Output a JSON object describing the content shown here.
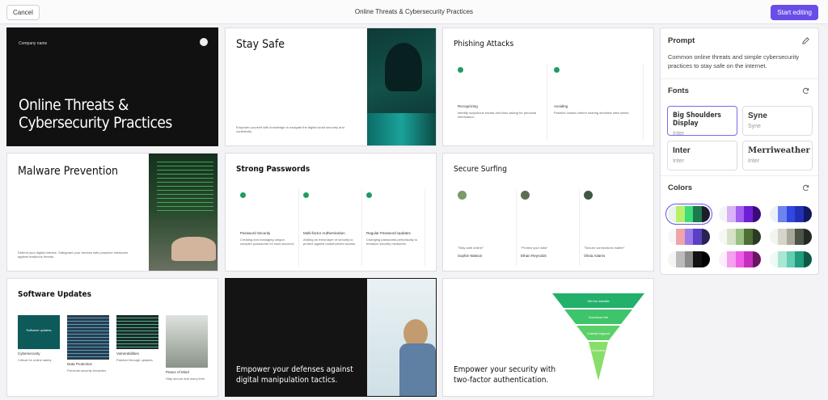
{
  "topbar": {
    "cancel": "Cancel",
    "title": "Online Threats & Cybersecurity Practices",
    "start": "Start editing"
  },
  "slides": {
    "s1": {
      "company": "Company name",
      "title": "Online Threats & Cybersecurity Practices"
    },
    "s2": {
      "title": "Stay Safe",
      "body": "Empower yourself with knowledge to navigate the digital world securely and confidently."
    },
    "s3": {
      "title": "Phishing Attacks",
      "items": [
        {
          "h": "Recognizing",
          "b": "Identify suspicious emails and links asking for personal information."
        },
        {
          "h": "Avoiding",
          "b": "Practice caution before sharing sensitive data online."
        }
      ]
    },
    "s4": {
      "title": "Malware Prevention",
      "body": "Defend your digital fortress. Safeguard your devices with proactive measures against malicious threats."
    },
    "s5": {
      "title": "Strong Passwords",
      "items": [
        {
          "h": "Password Security",
          "b": "Creating and managing unique, complex passwords for each account."
        },
        {
          "h": "Multi-factor Authentication",
          "b": "Adding an extra layer of security to protect against unauthorized access."
        },
        {
          "h": "Regular Password Updates",
          "b": "Changing passwords periodically to enhance security measures."
        }
      ]
    },
    "s6": {
      "title": "Secure Surfing",
      "items": [
        {
          "q": "\"Stay safe online!\"",
          "n": "Sophie Watson"
        },
        {
          "q": "\"Protect your data\"",
          "n": "Ethan Reynolds"
        },
        {
          "q": "\"Secure connections matter\"",
          "n": "Olivia Adams"
        }
      ]
    },
    "s7": {
      "title": "Software Updates",
      "items": [
        {
          "h": "Cybersecurity",
          "b": "Critical for online safety",
          "img": "Software updates"
        },
        {
          "h": "Data Protection",
          "b": "Prevents security breaches"
        },
        {
          "h": "Vulnerabilities",
          "b": "Patched through updates"
        },
        {
          "h": "Peace of Mind",
          "b": "Stay secure and worry-free"
        }
      ]
    },
    "s8": {
      "title": "Empower your defenses against digital manipulation tactics."
    },
    "s9": {
      "title": "Empower your security with two-factor authentication.",
      "levels": [
        "Set the website",
        "Download the",
        "Contact support",
        "Overview"
      ]
    }
  },
  "panel": {
    "prompt_title": "Prompt",
    "prompt_text": "Common online threats and simple cybersecurity practices to stay safe on the internet.",
    "fonts_title": "Fonts",
    "fonts": [
      {
        "name": "Big Shoulders Display",
        "sub": "Inter"
      },
      {
        "name": "Syne",
        "sub": "Syne"
      },
      {
        "name": "Inter",
        "sub": "Inter"
      },
      {
        "name": "Merriweather",
        "sub": "Inter"
      }
    ],
    "colors_title": "Colors",
    "palettes": [
      [
        "#e8f3ec",
        "#b7ef6a",
        "#3fdc7a",
        "#1b7a4e",
        "#1e1e2a"
      ],
      [
        "#f4f4f7",
        "#d8b3f7",
        "#a45ef0",
        "#6e1fd6",
        "#3b0a7a"
      ],
      [
        "#eef0f8",
        "#6d83ef",
        "#2f48e0",
        "#2230b8",
        "#11185e"
      ],
      [
        "#f7f7fa",
        "#f2a3a8",
        "#9a7be8",
        "#5b3fc4",
        "#2a2250"
      ],
      [
        "#f6f7f2",
        "#d7e3c8",
        "#9cbf83",
        "#4e6e36",
        "#2b3a22"
      ],
      [
        "#f4f4ef",
        "#d7d5c8",
        "#a9a79a",
        "#4b5447",
        "#222a22"
      ],
      [
        "#f4f4f4",
        "#bbbbbb",
        "#8a8a8a",
        "#111111",
        "#000000"
      ],
      [
        "#fbeefb",
        "#f49ff0",
        "#ee5ee5",
        "#c62ec0",
        "#6a1464"
      ],
      [
        "#eef9f5",
        "#a9e7d4",
        "#62cdb0",
        "#1f9c7d",
        "#0f5846"
      ]
    ]
  }
}
